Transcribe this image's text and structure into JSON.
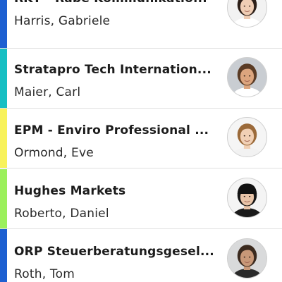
{
  "contacts": [
    {
      "company": "RKT - Rabe Kommunikatio...",
      "name": "Harris, Gabriele",
      "accent": "#1d5fd1",
      "avatar": "woman-dark-hair-avatar",
      "hair": "#2d1f18",
      "skin": "#efcdb4",
      "bg": "#f2f2f2",
      "cloth": "#ffffff"
    },
    {
      "company": "Stratapro Tech Internation...",
      "name": "Maier, Carl",
      "accent": "#17bfc3",
      "avatar": "man-brown-hair-avatar",
      "hair": "#5a3b25",
      "skin": "#dca57e",
      "bg": "#c9cdd2",
      "cloth": "#ffffff"
    },
    {
      "company": "EPM - Enviro Professional ...",
      "name": "Ormond, Eve",
      "accent": "#f8f25a",
      "avatar": "woman-blonde-avatar",
      "hair": "#9b6a3a",
      "skin": "#f1d0b5",
      "bg": "#f5f5f5",
      "cloth": "#f2f2f2"
    },
    {
      "company": "Hughes Markets",
      "name": "Roberto, Daniel",
      "accent": "#9bf05c",
      "avatar": "man-black-hat-avatar",
      "hair": "#151515",
      "skin": "#e8c4a8",
      "bg": "#f4f4f4",
      "cloth": "#1a1a1a"
    },
    {
      "company": "ORP Steuerberatungsgesel...",
      "name": "Roth, Tom",
      "accent": "#1d5fd1",
      "avatar": "man-phone-avatar",
      "hair": "#3b2a1f",
      "skin": "#c89878",
      "bg": "#d9dadb",
      "cloth": "#2a2a2a"
    }
  ]
}
